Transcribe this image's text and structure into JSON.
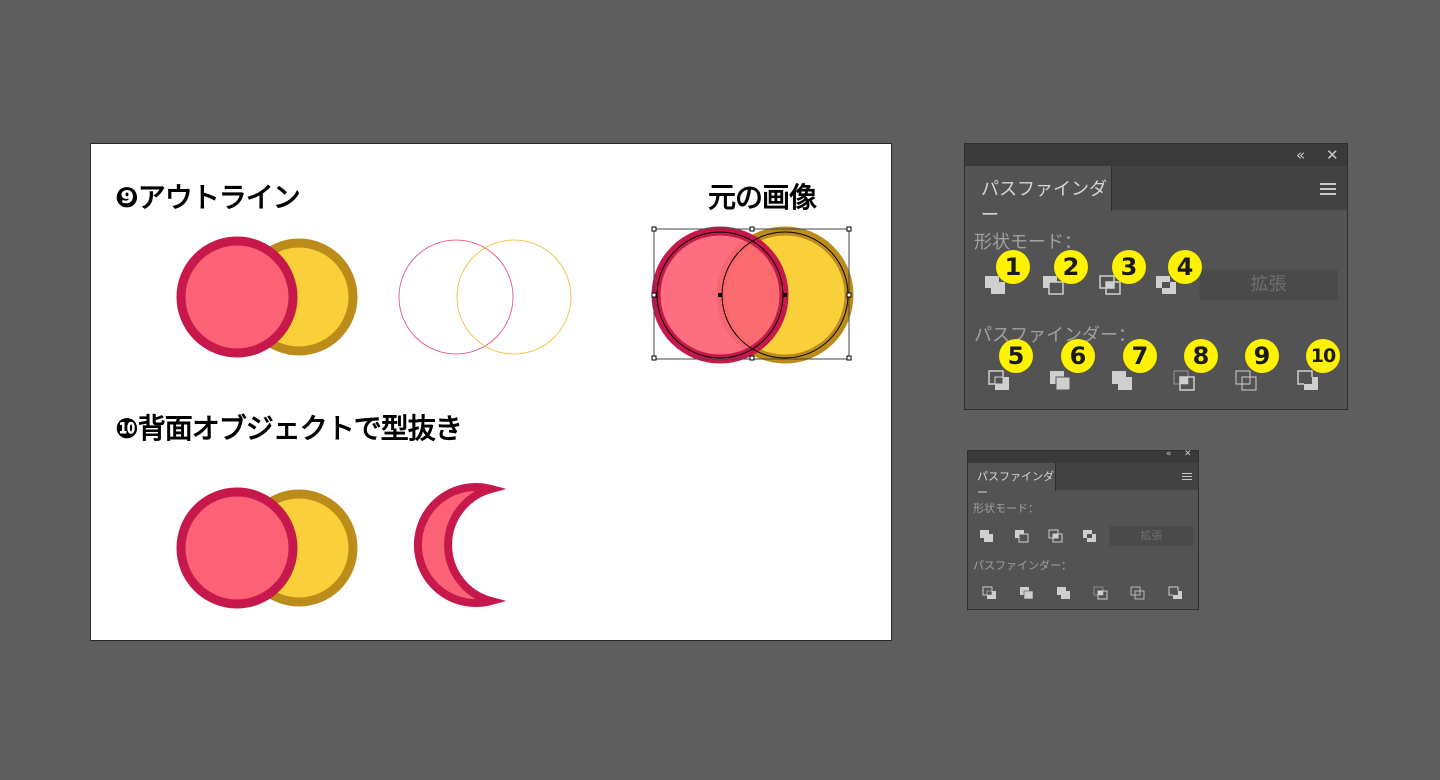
{
  "artboard": {
    "heading_outline": "❾アウトライン",
    "heading_original": "元の画像",
    "heading_minus_back": "❿背面オブジェクトで型抜き"
  },
  "colors": {
    "background": "#5e5e5e",
    "red_fill": "#fc6275",
    "red_stroke": "#c6184a",
    "yellow_fill": "#fad03a",
    "yellow_stroke": "#bb8c1a",
    "badge": "#fff200",
    "panel_bg": "#535353"
  },
  "panel_large": {
    "collapse_icon": "«",
    "close_icon": "✕",
    "tab_label": "パスファインダー",
    "menu_icon": "hamburger-menu-icon",
    "shape_modes_label": "形状モード：",
    "pathfinders_label": "パスファインダー：",
    "expand_label": "拡張",
    "badges": [
      "1",
      "2",
      "3",
      "4",
      "5",
      "6",
      "7",
      "8",
      "9",
      "10"
    ]
  },
  "panel_small": {
    "collapse_icon": "«",
    "close_icon": "✕",
    "tab_label": "パスファインダー",
    "shape_modes_label": "形状モード：",
    "pathfinders_label": "パスファインダー：",
    "expand_label": "拡張"
  }
}
